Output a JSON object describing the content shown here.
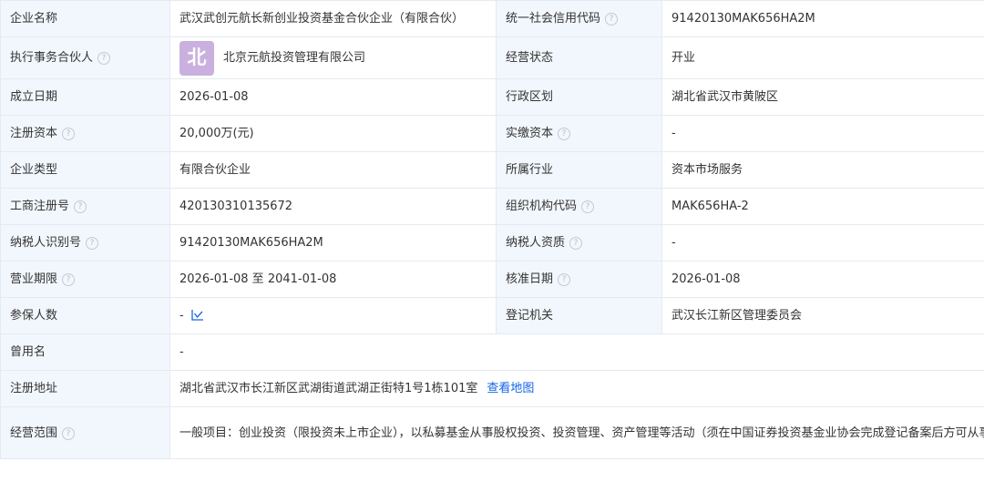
{
  "rows": {
    "company_name": {
      "label": "企业名称",
      "value": "武汉武创元航长新创业投资基金合伙企业（有限合伙）"
    },
    "credit_code": {
      "label": "统一社会信用代码",
      "value": "91420130MAK656HA2M"
    },
    "partner": {
      "label": "执行事务合伙人",
      "logo_char": "北",
      "value": "北京元航投资管理有限公司"
    },
    "status": {
      "label": "经营状态",
      "value": "开业"
    },
    "founded": {
      "label": "成立日期",
      "value": "2026-01-08"
    },
    "region": {
      "label": "行政区划",
      "value": "湖北省武汉市黄陂区"
    },
    "reg_capital": {
      "label": "注册资本",
      "value": "20,000万(元)"
    },
    "paid_capital": {
      "label": "实缴资本",
      "value": "-"
    },
    "type": {
      "label": "企业类型",
      "value": "有限合伙企业"
    },
    "industry": {
      "label": "所属行业",
      "value": "资本市场服务"
    },
    "reg_no": {
      "label": "工商注册号",
      "value": "420130310135672"
    },
    "org_code": {
      "label": "组织机构代码",
      "value": "MAK656HA-2"
    },
    "taxpayer_id": {
      "label": "纳税人识别号",
      "value": "91420130MAK656HA2M"
    },
    "taxpayer_qual": {
      "label": "纳税人资质",
      "value": "-"
    },
    "term": {
      "label": "营业期限",
      "value": "2026-01-08 至 2041-01-08"
    },
    "approval_date": {
      "label": "核准日期",
      "value": "2026-01-08"
    },
    "insured": {
      "label": "参保人数",
      "value": "-",
      "icon": "trend-chart-icon"
    },
    "authority": {
      "label": "登记机关",
      "value": "武汉长江新区管理委员会"
    },
    "former_name": {
      "label": "曾用名",
      "value": "-"
    },
    "address": {
      "label": "注册地址",
      "value": "湖北省武汉市长江新区武湖街道武湖正街特1号1栋101室",
      "map_link": "查看地图"
    },
    "scope": {
      "label": "经营范围",
      "value": "一般项目：创业投资（限投资未上市企业），以私募基金从事股权投资、投资管理、资产管理等活动（须在中国证券投资基金业协会完成登记备案后方可从事经营活动）。（除许可业务外，可自主依法经营法律法规非禁止或限制的项目）"
    }
  },
  "help_glyph": "?",
  "colors": {
    "label_bg": "#f2f7fd",
    "border": "#e4eaf2",
    "link": "#1565e6",
    "logo_bg": "#c9b0df"
  }
}
